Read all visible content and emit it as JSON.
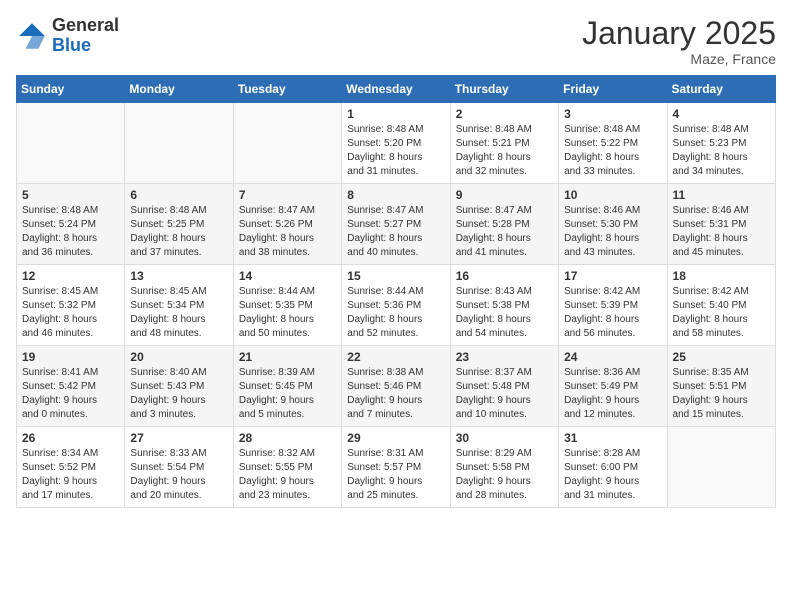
{
  "header": {
    "logo_general": "General",
    "logo_blue": "Blue",
    "month": "January 2025",
    "location": "Maze, France"
  },
  "weekdays": [
    "Sunday",
    "Monday",
    "Tuesday",
    "Wednesday",
    "Thursday",
    "Friday",
    "Saturday"
  ],
  "weeks": [
    [
      {
        "day": "",
        "info": ""
      },
      {
        "day": "",
        "info": ""
      },
      {
        "day": "",
        "info": ""
      },
      {
        "day": "1",
        "info": "Sunrise: 8:48 AM\nSunset: 5:20 PM\nDaylight: 8 hours\nand 31 minutes."
      },
      {
        "day": "2",
        "info": "Sunrise: 8:48 AM\nSunset: 5:21 PM\nDaylight: 8 hours\nand 32 minutes."
      },
      {
        "day": "3",
        "info": "Sunrise: 8:48 AM\nSunset: 5:22 PM\nDaylight: 8 hours\nand 33 minutes."
      },
      {
        "day": "4",
        "info": "Sunrise: 8:48 AM\nSunset: 5:23 PM\nDaylight: 8 hours\nand 34 minutes."
      }
    ],
    [
      {
        "day": "5",
        "info": "Sunrise: 8:48 AM\nSunset: 5:24 PM\nDaylight: 8 hours\nand 36 minutes."
      },
      {
        "day": "6",
        "info": "Sunrise: 8:48 AM\nSunset: 5:25 PM\nDaylight: 8 hours\nand 37 minutes."
      },
      {
        "day": "7",
        "info": "Sunrise: 8:47 AM\nSunset: 5:26 PM\nDaylight: 8 hours\nand 38 minutes."
      },
      {
        "day": "8",
        "info": "Sunrise: 8:47 AM\nSunset: 5:27 PM\nDaylight: 8 hours\nand 40 minutes."
      },
      {
        "day": "9",
        "info": "Sunrise: 8:47 AM\nSunset: 5:28 PM\nDaylight: 8 hours\nand 41 minutes."
      },
      {
        "day": "10",
        "info": "Sunrise: 8:46 AM\nSunset: 5:30 PM\nDaylight: 8 hours\nand 43 minutes."
      },
      {
        "day": "11",
        "info": "Sunrise: 8:46 AM\nSunset: 5:31 PM\nDaylight: 8 hours\nand 45 minutes."
      }
    ],
    [
      {
        "day": "12",
        "info": "Sunrise: 8:45 AM\nSunset: 5:32 PM\nDaylight: 8 hours\nand 46 minutes."
      },
      {
        "day": "13",
        "info": "Sunrise: 8:45 AM\nSunset: 5:34 PM\nDaylight: 8 hours\nand 48 minutes."
      },
      {
        "day": "14",
        "info": "Sunrise: 8:44 AM\nSunset: 5:35 PM\nDaylight: 8 hours\nand 50 minutes."
      },
      {
        "day": "15",
        "info": "Sunrise: 8:44 AM\nSunset: 5:36 PM\nDaylight: 8 hours\nand 52 minutes."
      },
      {
        "day": "16",
        "info": "Sunrise: 8:43 AM\nSunset: 5:38 PM\nDaylight: 8 hours\nand 54 minutes."
      },
      {
        "day": "17",
        "info": "Sunrise: 8:42 AM\nSunset: 5:39 PM\nDaylight: 8 hours\nand 56 minutes."
      },
      {
        "day": "18",
        "info": "Sunrise: 8:42 AM\nSunset: 5:40 PM\nDaylight: 8 hours\nand 58 minutes."
      }
    ],
    [
      {
        "day": "19",
        "info": "Sunrise: 8:41 AM\nSunset: 5:42 PM\nDaylight: 9 hours\nand 0 minutes."
      },
      {
        "day": "20",
        "info": "Sunrise: 8:40 AM\nSunset: 5:43 PM\nDaylight: 9 hours\nand 3 minutes."
      },
      {
        "day": "21",
        "info": "Sunrise: 8:39 AM\nSunset: 5:45 PM\nDaylight: 9 hours\nand 5 minutes."
      },
      {
        "day": "22",
        "info": "Sunrise: 8:38 AM\nSunset: 5:46 PM\nDaylight: 9 hours\nand 7 minutes."
      },
      {
        "day": "23",
        "info": "Sunrise: 8:37 AM\nSunset: 5:48 PM\nDaylight: 9 hours\nand 10 minutes."
      },
      {
        "day": "24",
        "info": "Sunrise: 8:36 AM\nSunset: 5:49 PM\nDaylight: 9 hours\nand 12 minutes."
      },
      {
        "day": "25",
        "info": "Sunrise: 8:35 AM\nSunset: 5:51 PM\nDaylight: 9 hours\nand 15 minutes."
      }
    ],
    [
      {
        "day": "26",
        "info": "Sunrise: 8:34 AM\nSunset: 5:52 PM\nDaylight: 9 hours\nand 17 minutes."
      },
      {
        "day": "27",
        "info": "Sunrise: 8:33 AM\nSunset: 5:54 PM\nDaylight: 9 hours\nand 20 minutes."
      },
      {
        "day": "28",
        "info": "Sunrise: 8:32 AM\nSunset: 5:55 PM\nDaylight: 9 hours\nand 23 minutes."
      },
      {
        "day": "29",
        "info": "Sunrise: 8:31 AM\nSunset: 5:57 PM\nDaylight: 9 hours\nand 25 minutes."
      },
      {
        "day": "30",
        "info": "Sunrise: 8:29 AM\nSunset: 5:58 PM\nDaylight: 9 hours\nand 28 minutes."
      },
      {
        "day": "31",
        "info": "Sunrise: 8:28 AM\nSunset: 6:00 PM\nDaylight: 9 hours\nand 31 minutes."
      },
      {
        "day": "",
        "info": ""
      }
    ]
  ]
}
